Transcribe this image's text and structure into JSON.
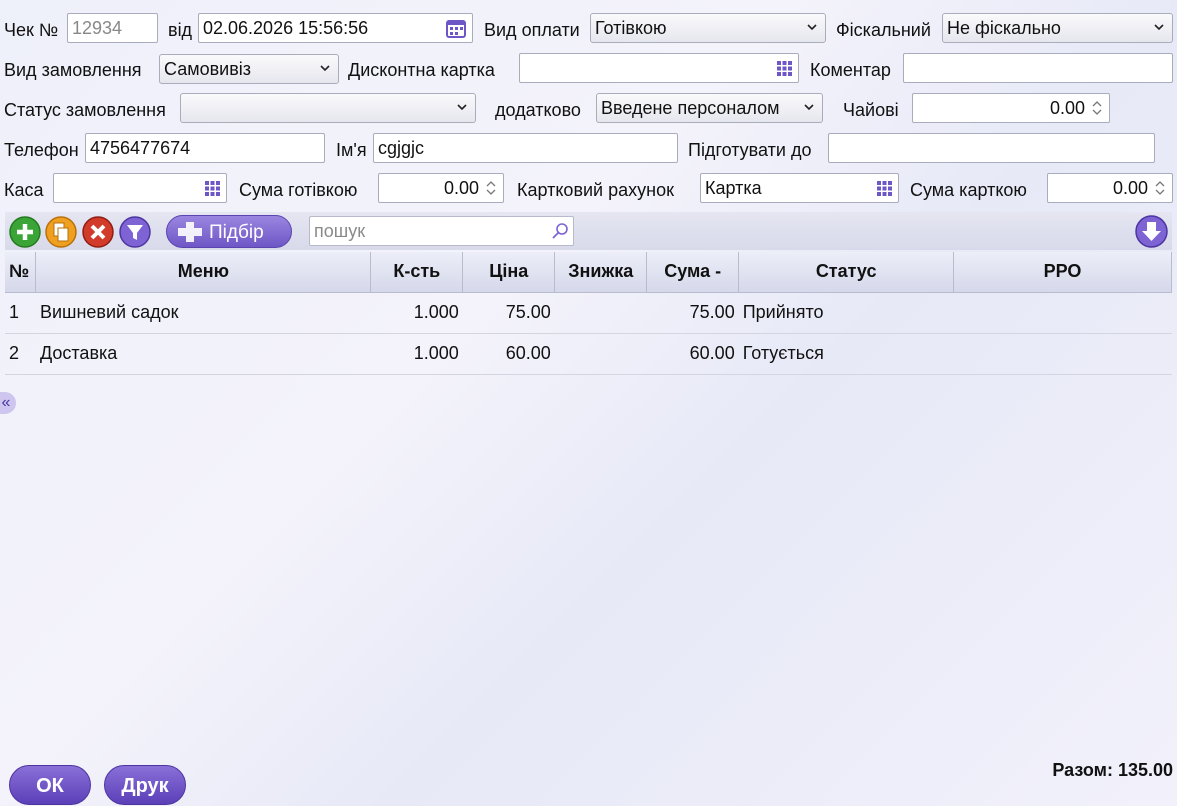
{
  "header": {
    "check_label": "Чек №",
    "check_number": "12934",
    "date_label": "від",
    "date_value": "02.06.2026 15:56:56",
    "payment_label": "Вид оплати",
    "payment_value": "Готівкою",
    "fiscal_label": "Фіскальний",
    "fiscal_value": "Не фіскально",
    "order_type_label": "Вид замовлення",
    "order_type_value": "Самовивіз",
    "discount_label": "Дисконтна картка",
    "discount_value": "",
    "comment_label": "Коментар",
    "comment_value": "",
    "status_label": "Статус замовлення",
    "status_value": "",
    "extra_label": "додатково",
    "extra_value": "Введене персоналом",
    "tips_label": "Чайові",
    "tips_value": "0.00",
    "phone_label": "Телефон",
    "phone_value": "4756477674",
    "name_label": "Ім'я",
    "name_value": "cgjgjc",
    "prepare_label": "Підготувати до",
    "prepare_value": "",
    "cash_register_label": "Каса",
    "cash_register_value": "",
    "cash_sum_label": "Сума готівкою",
    "cash_sum_value": "0.00",
    "card_account_label": "Картковий рахунок",
    "card_account_value": "Картка",
    "card_sum_label": "Сума карткою",
    "card_sum_value": "0.00"
  },
  "toolbar": {
    "pidbir_label": "Підбір",
    "search_placeholder": "пошук"
  },
  "table": {
    "columns": [
      "№",
      "Меню",
      "К-сть",
      "Ціна",
      "Знижка",
      "Сума -",
      "Статус",
      "РРО"
    ],
    "rows": [
      {
        "n": "1",
        "menu": "Вишневий садок",
        "qty": "1.000",
        "price": "75.00",
        "discount": "",
        "sum": "75.00",
        "status": "Прийнято",
        "rro": ""
      },
      {
        "n": "2",
        "menu": "Доставка",
        "qty": "1.000",
        "price": "60.00",
        "discount": "",
        "sum": "60.00",
        "status": "Готується",
        "rro": ""
      }
    ]
  },
  "footer": {
    "ok_label": "ОК",
    "print_label": "Друк",
    "total_text": "Разом: 135.00"
  },
  "side_toggle": "«",
  "colors": {
    "accent": "#6f56c6",
    "add": "#3aa536",
    "copy": "#f0a020",
    "delete": "#d23a2a"
  },
  "icons": [
    "calendar-icon",
    "chevron-down-icon",
    "grid-icon",
    "spinner-icon",
    "add-icon",
    "copy-icon",
    "delete-icon",
    "filter-icon",
    "search-icon",
    "arrow-down-icon"
  ]
}
